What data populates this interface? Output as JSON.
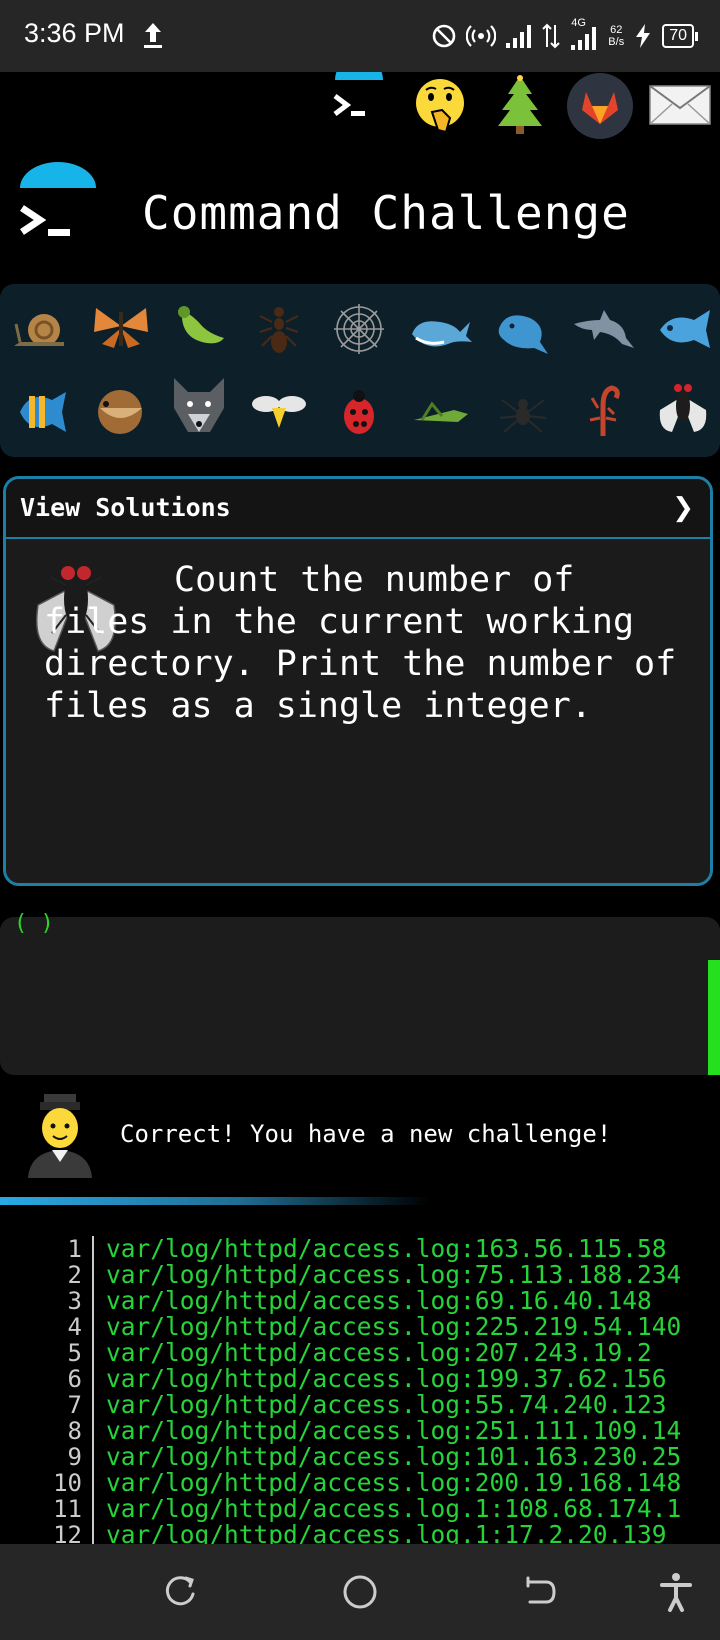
{
  "status_bar": {
    "time": "3:36 PM",
    "network_type": "4G",
    "speed_value": "62",
    "speed_unit": "B/s",
    "battery": "70"
  },
  "top_icons": [
    "terminal-icon",
    "shushing-face-icon",
    "tree-icon",
    "gitlab-icon",
    "envelope-icon"
  ],
  "header": {
    "title": "Command Challenge",
    "logo_icon": "terminal-icon"
  },
  "creatures": [
    "snail-icon",
    "butterfly-icon",
    "bug-icon",
    "ant-icon",
    "spider-web-icon",
    "whale-icon",
    "spouting-whale-icon",
    "dolphin-icon",
    "fish-icon",
    "tropical-fish-icon",
    "blowfish-icon",
    "wolf-icon",
    "bee-icon",
    "ladybug-icon",
    "cricket-icon",
    "spider-icon",
    "scorpion-icon",
    "fly-icon"
  ],
  "challenge": {
    "view_solutions_label": "View Solutions",
    "chevron": "❯",
    "icon": "fly-icon",
    "description": "Count the number of files in the current working directory. Print the number of files as a single integer."
  },
  "terminal": {
    "prompt_fragment": "( )"
  },
  "result": {
    "message": "Correct! You have a new challenge!"
  },
  "output": {
    "lines": [
      {
        "n": "1",
        "text": "var/log/httpd/access.log:163.56.115.58"
      },
      {
        "n": "2",
        "text": "var/log/httpd/access.log:75.113.188.234"
      },
      {
        "n": "3",
        "text": "var/log/httpd/access.log:69.16.40.148"
      },
      {
        "n": "4",
        "text": "var/log/httpd/access.log:225.219.54.140"
      },
      {
        "n": "5",
        "text": "var/log/httpd/access.log:207.243.19.2"
      },
      {
        "n": "6",
        "text": "var/log/httpd/access.log:199.37.62.156"
      },
      {
        "n": "7",
        "text": "var/log/httpd/access.log:55.74.240.123"
      },
      {
        "n": "8",
        "text": "var/log/httpd/access.log:251.111.109.14"
      },
      {
        "n": "9",
        "text": "var/log/httpd/access.log:101.163.230.25"
      },
      {
        "n": "10",
        "text": "var/log/httpd/access.log:200.19.168.148"
      },
      {
        "n": "11",
        "text": "var/log/httpd/access.log.1:108.68.174.1"
      },
      {
        "n": "12",
        "text": "var/log/httpd/access.log.1:17.2.20.139"
      }
    ]
  },
  "nav_bar": [
    "recents-icon",
    "home-icon",
    "back-icon",
    "accessibility-icon"
  ]
}
